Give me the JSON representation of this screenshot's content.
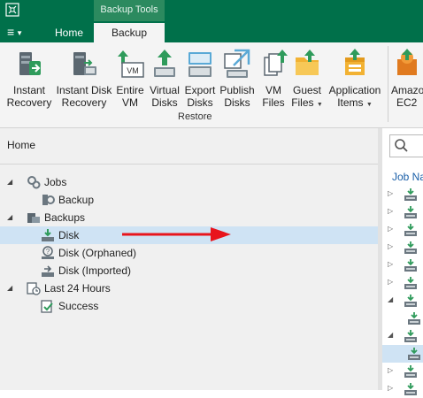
{
  "titlebar": {
    "context_tab": "Backup Tools",
    "menu_glyph": "≡",
    "tabs": [
      {
        "label": "Home",
        "active": false
      },
      {
        "label": "Backup",
        "active": true
      }
    ]
  },
  "ribbon": {
    "buttons": [
      {
        "line1": "Instant",
        "line2": "Recovery",
        "icon": "instant-recovery-icon"
      },
      {
        "line1": "Instant Disk",
        "line2": "Recovery",
        "icon": "instant-disk-recovery-icon"
      },
      {
        "line1": "Entire",
        "line2": "VM",
        "icon": "entire-vm-icon"
      },
      {
        "line1": "Virtual",
        "line2": "Disks",
        "icon": "virtual-disks-icon"
      },
      {
        "line1": "Export",
        "line2": "Disks",
        "icon": "export-disks-icon"
      },
      {
        "line1": "Publish",
        "line2": "Disks",
        "icon": "publish-disks-icon"
      },
      {
        "line1": "VM",
        "line2": "Files",
        "icon": "vm-files-icon"
      },
      {
        "line1": "Guest",
        "line2": "Files",
        "icon": "guest-files-icon"
      },
      {
        "line1": "Application",
        "line2": "Items",
        "icon": "application-items-icon"
      },
      {
        "line1": "Amazo",
        "line2": "EC2",
        "icon": "amazon-ec2-icon"
      }
    ],
    "group_label": "Restore"
  },
  "left_panel": {
    "title": "Home",
    "tree": [
      {
        "label": "Jobs",
        "expander": "◢",
        "icon": "jobs-icon"
      },
      {
        "label": "Backup",
        "expander": "",
        "icon": "backup-job-icon"
      },
      {
        "label": "Backups",
        "expander": "◢",
        "icon": "backups-icon"
      },
      {
        "label": "Disk",
        "expander": "",
        "icon": "disk-icon",
        "selected": true
      },
      {
        "label": "Disk (Orphaned)",
        "expander": "",
        "icon": "disk-orphaned-icon"
      },
      {
        "label": "Disk (Imported)",
        "expander": "",
        "icon": "disk-imported-icon"
      },
      {
        "label": "Last 24 Hours",
        "expander": "◢",
        "icon": "last-24-hours-icon"
      },
      {
        "label": "Success",
        "expander": "",
        "icon": "success-icon"
      }
    ]
  },
  "right_panel": {
    "search_icon": "search-icon",
    "column_header": "Job Na",
    "row_expanders": [
      "▷",
      "▷",
      "▷",
      "▷",
      "▷",
      "▷",
      "◢",
      "",
      "◢",
      "",
      "▷",
      "▷"
    ]
  },
  "colors": {
    "brand": "#00704a",
    "selection": "#cfe3f4",
    "annotation_arrow": "#e8141c"
  }
}
